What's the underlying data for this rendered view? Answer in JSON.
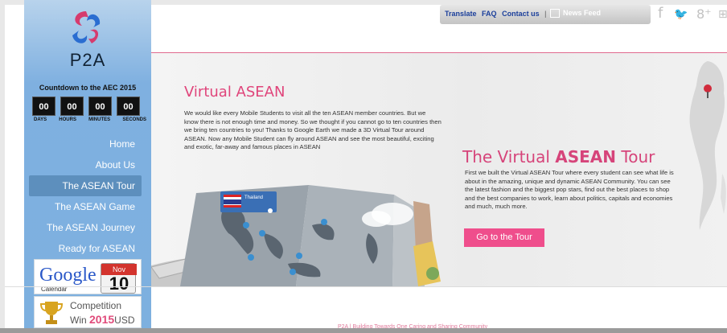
{
  "brand": {
    "name": "P2A"
  },
  "countdown": {
    "title": "Countdown to the AEC 2015",
    "values": [
      "00",
      "00",
      "00",
      "00"
    ],
    "labels": [
      "DAYS",
      "HOURS",
      "MINUTES",
      "SECONDS"
    ]
  },
  "nav": {
    "items": [
      {
        "label": "Home"
      },
      {
        "label": "About Us"
      },
      {
        "label": "The ASEAN Tour"
      },
      {
        "label": "The ASEAN Game"
      },
      {
        "label": "The ASEAN Journey"
      },
      {
        "label": "Ready for ASEAN"
      }
    ],
    "active_index": 2
  },
  "promos": {
    "calendar": {
      "logo": "Google",
      "caption": "Calendar",
      "month": "Nov",
      "day": "10"
    },
    "competition": {
      "line1": "Competition",
      "win": "Win",
      "amount": "2015",
      "currency": "USD"
    }
  },
  "topbar": {
    "links": [
      "Translate",
      "FAQ",
      "Contact us"
    ],
    "separator": "|",
    "news_feed": "News Feed"
  },
  "social": {
    "icons": [
      "facebook-icon",
      "twitter-icon",
      "google-plus-icon",
      "more-icon"
    ],
    "glyphs": [
      "f",
      "🐦",
      "8⁺",
      "⊞"
    ]
  },
  "virtual_asean": {
    "title": "Virtual ASEAN",
    "body": "We would like every Mobile Students to visit all the ten ASEAN member countries. But we know there is not enough time and money. So we thought if you cannot go to ten countries then we bring ten countries to you! Thanks to Google Earth we made a 3D Virtual Tour around ASEAN. Now any Mobile Student can fly around ASEAN and see the most beautiful, exciting and exotic, far-away and famous places in ASEAN"
  },
  "map": {
    "tag": "Thailand"
  },
  "tour": {
    "title_part1": "The Virtual",
    "title_part2": "ASEAN",
    "title_part3": "Tour",
    "body": "First we built the Virtual ASEAN Tour where every student can see what life is about in the amazing, unique and dynamic ASEAN Community. You can see the latest fashion and the biggest pop stars, find out the best places to shop and the best companies to work, learn about politics, capitals and economies and much, much more.",
    "button": "Go to the Tour"
  },
  "footer": {
    "text": "P2A | Building Towards One Caring and Sharing Community"
  },
  "colors": {
    "accent": "#e0457b",
    "sidebar": "#7fb0e0",
    "button": "#ef4e8c"
  }
}
